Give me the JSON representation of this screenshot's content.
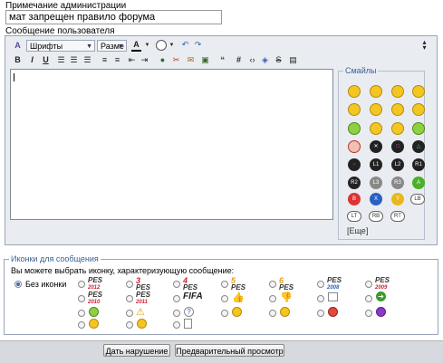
{
  "admin_note": {
    "label": "Примечание администрации",
    "value": "мат запрещен правило форума"
  },
  "message": {
    "label": "Сообщение пользователя",
    "font_select": "Шрифты",
    "size_select": "Разме"
  },
  "smileys": {
    "legend": "Смайлы",
    "more": "[Еще]",
    "buttons_row": [
      "L1",
      "L2",
      "R1"
    ],
    "buttons_row2": [
      "",
      "",
      ""
    ],
    "buttons_row3": [
      "B",
      "X",
      "Y",
      "LB"
    ],
    "buttons_row4": [
      "LT",
      "RB",
      "RT"
    ]
  },
  "post_icons": {
    "legend": "Иконки для сообщения",
    "prompt": "Вы можете выбрать иконку, характеризующую сообщение:",
    "no_icon": "Без иконки",
    "pes_labels": [
      "PES",
      "PES",
      "PES",
      "PES",
      "PES",
      "PES",
      "PES",
      "PES",
      "PES"
    ],
    "pes_years": [
      "2012",
      "3",
      "4",
      "5",
      "6",
      "2008",
      "2009",
      "2010",
      "2011"
    ],
    "fifa": "FIFA"
  },
  "actions": {
    "submit_label": "Дать нарушение",
    "preview_label": "Предварительный просмотр"
  },
  "colors": {
    "editor_bg": "#e9ecf1",
    "legend_text": "#3a5f98",
    "smiley_yellow": "#f3c622"
  }
}
